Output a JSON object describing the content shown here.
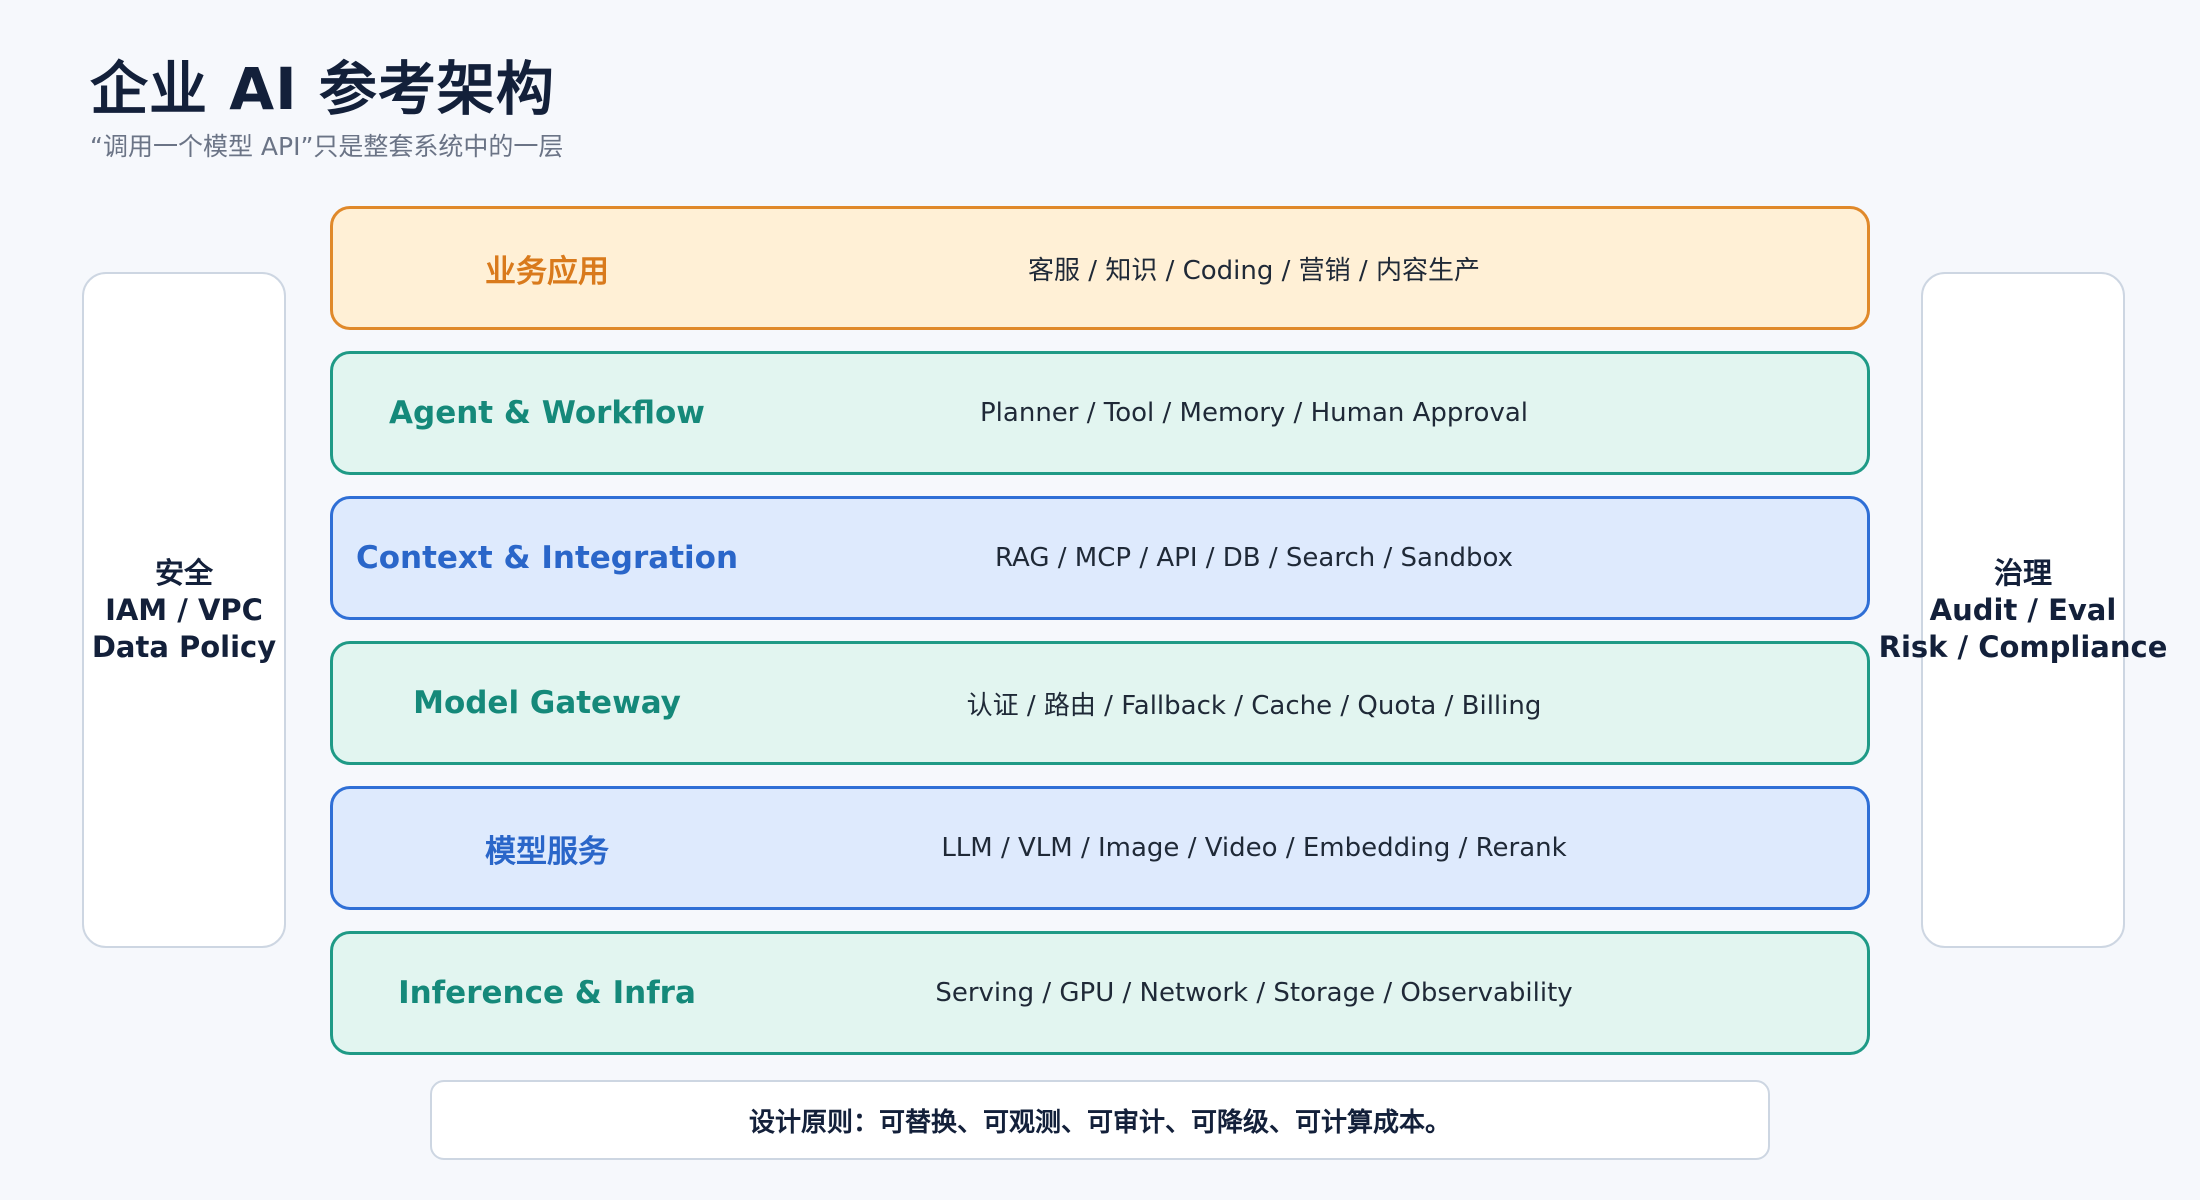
{
  "header": {
    "title": "企业 AI 参考架构",
    "subtitle": "“调用一个模型 API”只是整套系统中的一层"
  },
  "left_panel": {
    "lines": [
      "安全",
      "IAM / VPC",
      "Data Policy"
    ]
  },
  "right_panel": {
    "lines": [
      "治理",
      "Audit / Eval",
      "Risk / Compliance"
    ]
  },
  "layers": [
    {
      "name": "业务应用",
      "desc": "客服 / 知识 / Coding / 营销 / 内容生产",
      "fill": "#fff0d6",
      "border": "#e0892a",
      "text": "#d97a1c"
    },
    {
      "name": "Agent & Workflow",
      "desc": "Planner / Tool / Memory / Human Approval",
      "fill": "#e2f5f0",
      "border": "#1f9a86",
      "text": "#15897a"
    },
    {
      "name": "Context & Integration",
      "desc": "RAG / MCP / API / DB / Search / Sandbox",
      "fill": "#deeafd",
      "border": "#2f6fd6",
      "text": "#2a66c9"
    },
    {
      "name": "Model Gateway",
      "desc": "认证 / 路由 / Fallback / Cache / Quota / Billing",
      "fill": "#e2f5f0",
      "border": "#1f9a86",
      "text": "#15897a"
    },
    {
      "name": "模型服务",
      "desc": "LLM / VLM / Image / Video / Embedding / Rerank",
      "fill": "#deeafd",
      "border": "#2f6fd6",
      "text": "#2a66c9"
    },
    {
      "name": "Inference & Infra",
      "desc": "Serving / GPU / Network / Storage / Observability",
      "fill": "#e2f5f0",
      "border": "#1f9a86",
      "text": "#15897a"
    }
  ],
  "footer": {
    "text": "设计原则：可替换、可观测、可审计、可降级、可计算成本。"
  }
}
